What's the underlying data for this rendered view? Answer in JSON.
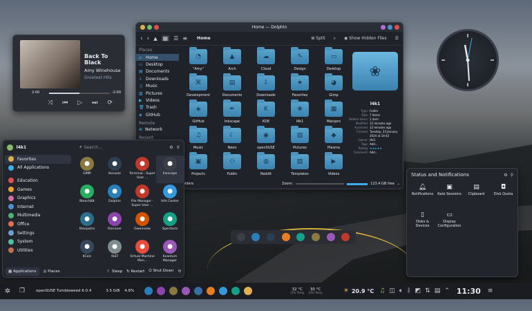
{
  "player": {
    "title": "Back To Black",
    "artist": "Amy Winehouse",
    "album": "Greatest Hits",
    "elapsed": "2:00",
    "remaining": "-2:00",
    "progress": 0.5
  },
  "dolphin": {
    "window_title": "Home — Dolphin",
    "location": "Home",
    "split_label": "Split",
    "hidden_label": "Show Hidden Files",
    "places_header": "Places",
    "places": [
      "Home",
      "Desktop",
      "Documents",
      "Downloads",
      "Music",
      "Pictures",
      "Videos",
      "Trash",
      "GitHub"
    ],
    "remote_header": "Remote",
    "remote": [
      "Network"
    ],
    "recent_header": "Recent",
    "files": [
      [
        "\"Amy\"",
        "Arch",
        "Cloud",
        "Design",
        "Desktop"
      ],
      [
        "Development",
        "Documents",
        "Downloads",
        "Favorites",
        "Gimp"
      ],
      [
        "GitHub",
        "Inkscape",
        "KDE",
        "l4k1",
        "Manjaro"
      ],
      [
        "Music",
        "Neon",
        "openSUSE",
        "Pictures",
        "Plasma"
      ],
      [
        "Projects",
        "Public",
        "Reddit",
        "Templates",
        "Videos"
      ]
    ],
    "info": {
      "name": "l4k1",
      "rows": [
        [
          "Type:",
          "Folder"
        ],
        [
          "Size:",
          "7 items"
        ],
        [
          "Hidden items:",
          "1 item"
        ],
        [
          "Modified:",
          "12 minutes ago"
        ],
        [
          "Accessed:",
          "12 minutes ago"
        ],
        [
          "Created:",
          "Tuesday, 23 January 2024 at 14:42"
        ],
        [
          "Owner:",
          "l4k1"
        ],
        [
          "Tags:",
          "Add..."
        ],
        [
          "Rating:",
          "★★★★★"
        ],
        [
          "Comment:",
          "Add..."
        ]
      ]
    },
    "status_left": "folders",
    "zoom_label": "Zoom:",
    "free": "123.4 GB free"
  },
  "launcher": {
    "user": "l4k1",
    "search_placeholder": "Search...",
    "categories": [
      "Favorites",
      "All Applications",
      "Education",
      "Games",
      "Graphics",
      "Internet",
      "Multimedia",
      "Office",
      "Settings",
      "System",
      "Utilities"
    ],
    "apps": [
      "GIMP",
      "Konsole",
      "Terminal - Super User ...",
      "Inkscape",
      "BleachBit",
      "Dolphin",
      "File Manager - Super User ...",
      "Info Center",
      "Kleopatra",
      "Discover",
      "Gwenview",
      "Spectacle",
      "KCalc",
      "YaST",
      "Virtual Machine Man...",
      "Kvantum Manager"
    ],
    "tab_apps": "Applications",
    "tab_places": "Places",
    "sleep": "Sleep",
    "restart": "Restart",
    "shutdown": "Shut Down"
  },
  "status": {
    "title": "Status and Notifications",
    "items": [
      "Notifications",
      "Kate Sessions",
      "Clipboard",
      "Disk Quota",
      "Disks & Devices",
      "Display Configuration"
    ]
  },
  "panel": {
    "distro": "openSUSE Tumbleweed 6.0.4",
    "ram": "3.5 GiB",
    "cpu": "4.6%",
    "cpu_temp": "32 °C",
    "cpu_temp_label": "CPU Temp",
    "gpu_temp": "30 °C",
    "gpu_temp_label": "GPU Temp",
    "weather": "20.9 °C",
    "clock": "11:30"
  },
  "colors": {
    "accent": "#3daee9",
    "window": "#1f2229"
  }
}
